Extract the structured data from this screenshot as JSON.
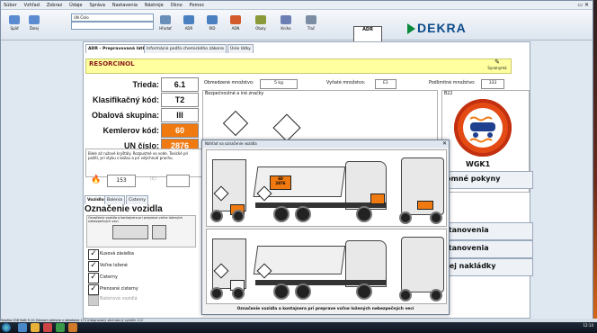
{
  "menu": [
    "Súbor",
    "Vzhľad",
    "Zobraz",
    "Údaje",
    "Správa",
    "Nastavenia",
    "Nástroje",
    "Okno",
    "Pomoc"
  ],
  "toolbar": {
    "left_buttons": [
      "Späť",
      "Ďalej"
    ],
    "combo_value": "UN Číslo",
    "buttons": [
      "Hľadať",
      "ADR",
      "RID",
      "ADN",
      "Obaly",
      "Kniha",
      "Tlač"
    ]
  },
  "brand": {
    "name": "DEKRA",
    "adr_label": "ADR"
  },
  "tabs": [
    "ADR - Prepravovaná látka",
    "Informácie podľa chemického zákona",
    "Úniк látky"
  ],
  "substance": {
    "name": "RESORCINOL",
    "synonyms_label": "Synonymá"
  },
  "fields": [
    {
      "label": "Trieda:",
      "value": "6.1",
      "orange": false
    },
    {
      "label": "Klasifikačný kód:",
      "value": "T2",
      "orange": false
    },
    {
      "label": "Obalová skupina:",
      "value": "III",
      "orange": false
    },
    {
      "label": "Kemlerov kód:",
      "value": "60",
      "orange": true
    },
    {
      "label": "UN číslo:",
      "value": "2876",
      "orange": true
    }
  ],
  "limits": {
    "limited_label": "Obmedzené množstvo:",
    "limited_value": "5 kg",
    "excepted_label": "Vyňaté množstvo:",
    "excepted_value": "E1",
    "threshold_label": "Podlimitné množstvo:",
    "threshold_value": "333"
  },
  "safety_label": "Bezpečnostné a iné značky",
  "code_box": "B22",
  "wgk": "WGK1",
  "side_buttons": [
    "omné pokyny",
    "stanovenia",
    "stanovenia",
    "nej nakládky"
  ],
  "tunnel": {
    "number": "153",
    "code_label": "(E)"
  },
  "description": "Biele až ružové kryštály. Rozpustné vo vode. Toxické pri požití, pri styku s kožou a pri vdýchnutí prachu.",
  "lower_tabs": [
    "Vozidlo",
    "Balenia",
    "Cisterny"
  ],
  "marking_title": "Označenie vozidla",
  "marking_caption": "Označenie vozidla a kontajnera pri preprave voľne ložených nebezpečných vecí",
  "checkboxes": [
    {
      "label": "Kusová zásielka",
      "checked": true
    },
    {
      "label": "Voľne ložené",
      "checked": true
    },
    {
      "label": "Cisterny",
      "checked": true
    },
    {
      "label": "Prenosné cisterny",
      "checked": true
    },
    {
      "label": "Batériové vozidlá",
      "checked": false
    }
  ],
  "dialog_title": "Náhľad na označenie vozidla",
  "plate": {
    "top": "60",
    "bottom": "2876"
  },
  "statusbar": "Položka 258   Naši 9.10   Záznam aktívne v databáze 171   Integrovaný záchranný systém 112",
  "clock": "12:14"
}
